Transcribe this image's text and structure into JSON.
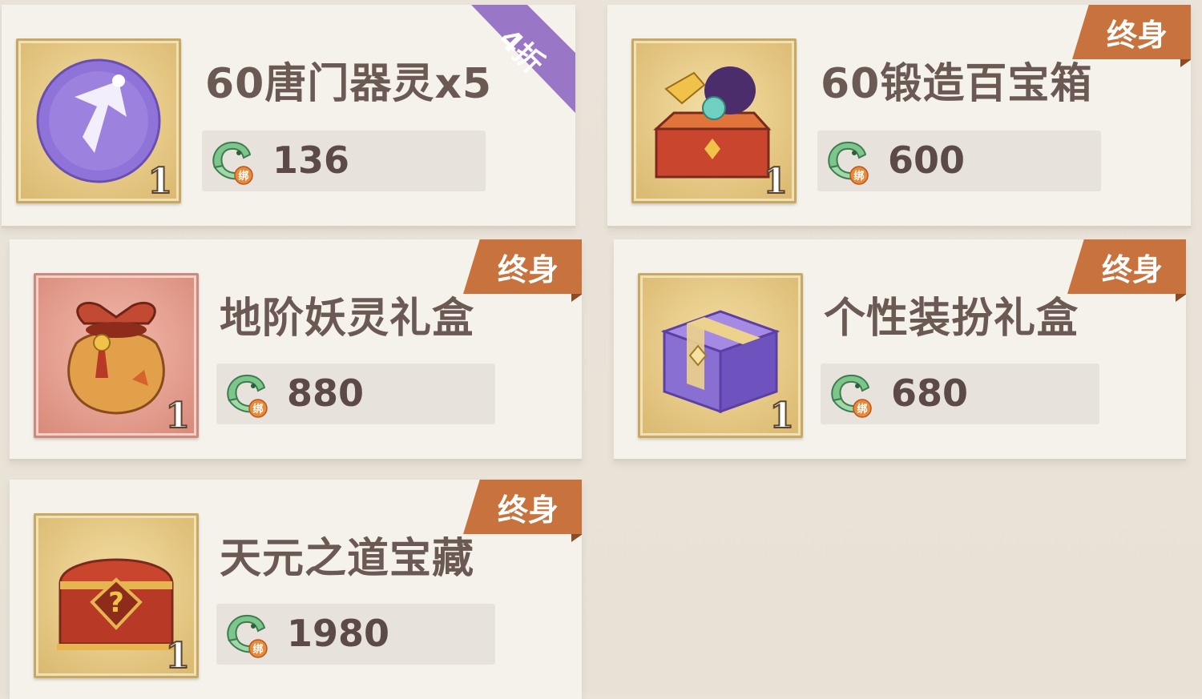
{
  "items": [
    {
      "title": "60唐门器灵x5",
      "qty": "1",
      "price": "136",
      "tag": "4折",
      "icon": "purple-orb-icon"
    },
    {
      "title": "60锻造百宝箱",
      "qty": "1",
      "price": "600",
      "tag": "终身",
      "icon": "treasure-chest-open-icon"
    },
    {
      "title": "地阶妖灵礼盒",
      "qty": "1",
      "price": "880",
      "tag": "终身",
      "icon": "red-pouch-icon"
    },
    {
      "title": "个性装扮礼盒",
      "qty": "1",
      "price": "680",
      "tag": "终身",
      "icon": "purple-giftbox-icon"
    },
    {
      "title": "天元之道宝藏",
      "qty": "1",
      "price": "1980",
      "tag": "终身",
      "icon": "mystery-chest-icon"
    }
  ],
  "currency": {
    "icon": "bound-jade-coin-icon",
    "badge": "绑"
  },
  "colors": {
    "tag_orange": "#c8733d",
    "discount_purple": "#9a76c7",
    "card_bg": "#f5f2ec"
  }
}
